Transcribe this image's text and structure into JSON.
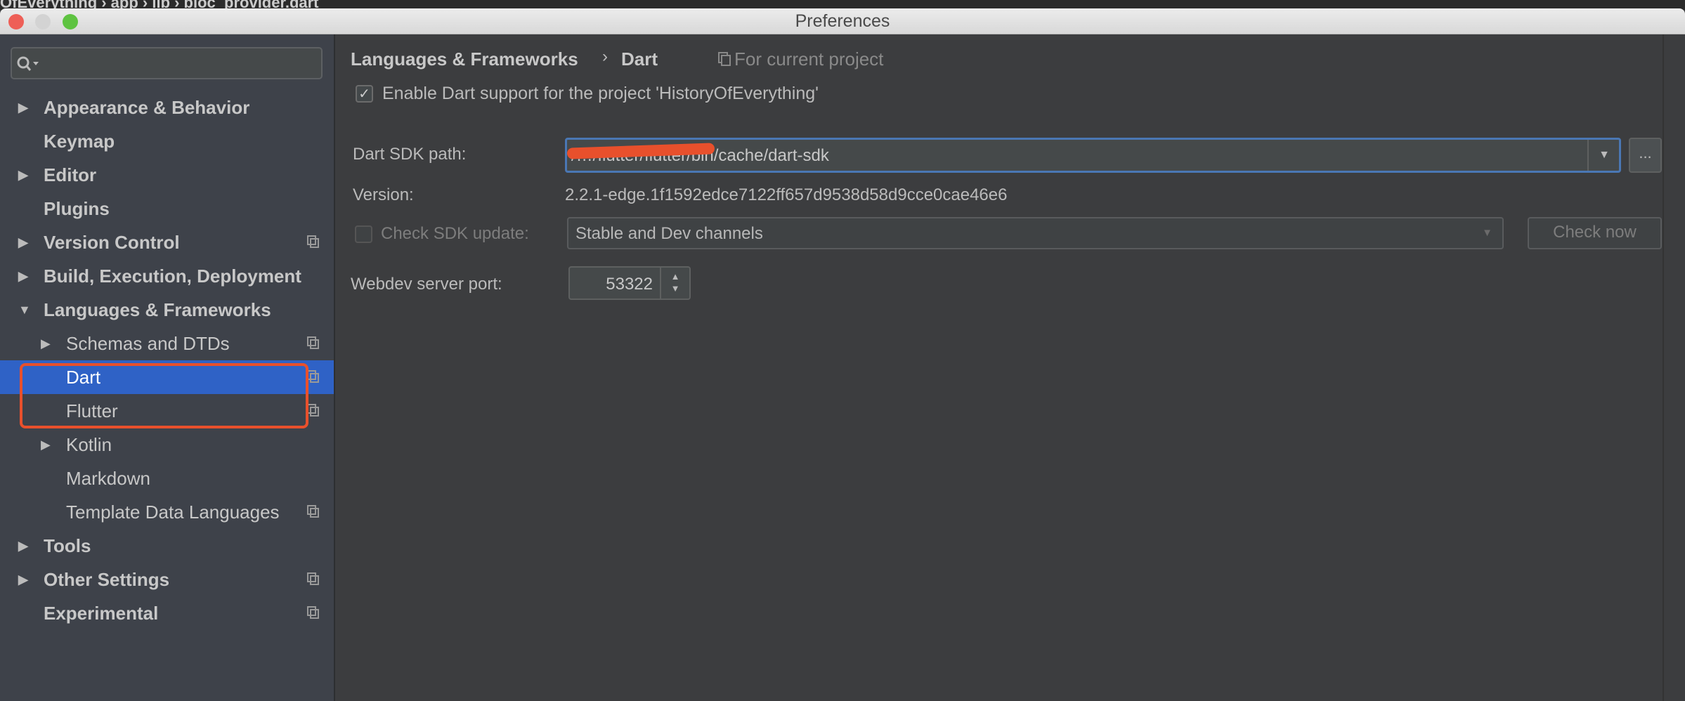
{
  "background_breadcrumb": "OfEverything  ›  app  ›  lib  ›  bloc_provider.dart",
  "window": {
    "title": "Preferences"
  },
  "sidebar": {
    "search_placeholder": "",
    "items": [
      {
        "label": "Appearance & Behavior",
        "expandable": true,
        "level": 0
      },
      {
        "label": "Keymap",
        "level": 0
      },
      {
        "label": "Editor",
        "expandable": true,
        "level": 0
      },
      {
        "label": "Plugins",
        "level": 0
      },
      {
        "label": "Version Control",
        "expandable": true,
        "level": 0,
        "project_icon": true
      },
      {
        "label": "Build, Execution, Deployment",
        "expandable": true,
        "level": 0
      },
      {
        "label": "Languages & Frameworks",
        "expanded": true,
        "level": 0
      },
      {
        "label": "Schemas and DTDs",
        "expandable": true,
        "level": 1,
        "project_icon": true
      },
      {
        "label": "Dart",
        "level": 1,
        "selected": true,
        "project_icon": true
      },
      {
        "label": "Flutter",
        "level": 1,
        "project_icon": true
      },
      {
        "label": "Kotlin",
        "expandable": true,
        "level": 1
      },
      {
        "label": "Markdown",
        "level": 1
      },
      {
        "label": "Template Data Languages",
        "level": 1,
        "project_icon": true
      },
      {
        "label": "Tools",
        "expandable": true,
        "level": 0
      },
      {
        "label": "Other Settings",
        "expandable": true,
        "level": 0,
        "project_icon": true
      },
      {
        "label": "Experimental",
        "level": 0,
        "project_icon": true
      }
    ]
  },
  "main": {
    "breadcrumb": {
      "parent": "Languages & Frameworks",
      "separator": "›",
      "current": "Dart",
      "scope": "For current project"
    },
    "enable_dart": {
      "label": "Enable Dart support for the project 'HistoryOfEverything'",
      "checked": true
    },
    "sdk_path": {
      "label": "Dart SDK path:",
      "value": "/…/flutter/flutter/bin/cache/dart-sdk",
      "browse": "..."
    },
    "version": {
      "label": "Version:",
      "value": "2.2.1-edge.1f1592edce7122ff657d9538d58d9cce0cae46e6"
    },
    "check_update": {
      "label": "Check SDK update:",
      "checked": false,
      "channel": "Stable and Dev channels",
      "button": "Check now"
    },
    "webdev": {
      "label": "Webdev server port:",
      "value": "53322"
    }
  },
  "colors": {
    "selection": "#2f62c6",
    "highlight_box": "#e8502c",
    "focus": "#4a77b4"
  }
}
